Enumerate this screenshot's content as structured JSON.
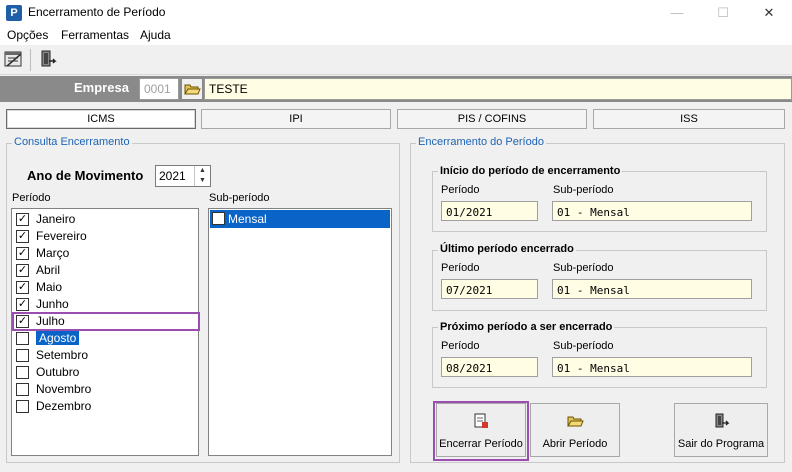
{
  "window": {
    "title": "Encerramento de Período",
    "icon_letter": "P",
    "minimize": "—",
    "maximize": "☐",
    "close": "✕"
  },
  "menu": [
    "Opções",
    "Ferramentas",
    "Ajuda"
  ],
  "empresa": {
    "label": "Empresa",
    "code": "0001",
    "name": "TESTE"
  },
  "tabs": [
    "ICMS",
    "IPI",
    "PIS / COFINS",
    "ISS"
  ],
  "consulta": {
    "title": "Consulta Encerramento",
    "ano_label": "Ano de Movimento",
    "ano_value": "2021",
    "periodo_label": "Período",
    "subperiodo_label": "Sub-período",
    "months": [
      {
        "name": "Janeiro",
        "checked": true
      },
      {
        "name": "Fevereiro",
        "checked": true
      },
      {
        "name": "Março",
        "checked": true
      },
      {
        "name": "Abril",
        "checked": true
      },
      {
        "name": "Maio",
        "checked": true
      },
      {
        "name": "Junho",
        "checked": true
      },
      {
        "name": "Julho",
        "checked": true
      },
      {
        "name": "Agosto",
        "checked": false
      },
      {
        "name": "Setembro",
        "checked": false
      },
      {
        "name": "Outubro",
        "checked": false
      },
      {
        "name": "Novembro",
        "checked": false
      },
      {
        "name": "Dezembro",
        "checked": false
      }
    ],
    "selected_month": "Agosto",
    "subperiods": [
      {
        "name": "Mensal",
        "checked": false
      }
    ]
  },
  "encerramento": {
    "title": "Encerramento do Período",
    "inicio": {
      "title": "Início do período de encerramento",
      "periodo_label": "Período",
      "sub_label": "Sub-período",
      "periodo": "01/2021",
      "sub": "01 - Mensal"
    },
    "ultimo": {
      "title": "Último período encerrado",
      "periodo_label": "Período",
      "sub_label": "Sub-período",
      "periodo": "07/2021",
      "sub": "01 - Mensal"
    },
    "proximo": {
      "title": "Próximo período a ser encerrado",
      "periodo_label": "Período",
      "sub_label": "Sub-período",
      "periodo": "08/2021",
      "sub": "01 - Mensal"
    }
  },
  "buttons": {
    "encerrar": "Encerrar Período",
    "abrir": "Abrir Período",
    "sair": "Sair do Programa"
  },
  "colors": {
    "accent": "#1e64b4",
    "highlight": "#9a4fb0",
    "field_bg": "#fffde3",
    "selection": "#0a64c8"
  }
}
